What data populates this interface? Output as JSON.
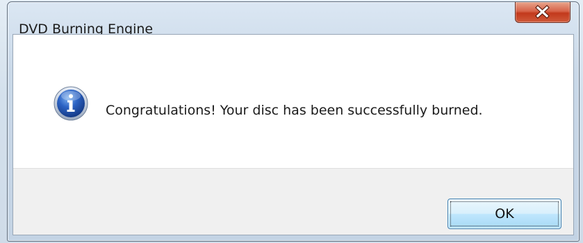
{
  "window": {
    "title": "DVD Burning Engine",
    "close_icon": "close-x-icon"
  },
  "dialog": {
    "icon": "information-icon",
    "message": "Congratulations! Your disc has been successfully burned."
  },
  "buttons": {
    "ok_label": "OK"
  },
  "colors": {
    "close_button": "#c2391c",
    "info_icon_blue": "#1d4fa5",
    "ok_button_border": "#3c7fb1",
    "footer_bg": "#f0f0f0"
  }
}
